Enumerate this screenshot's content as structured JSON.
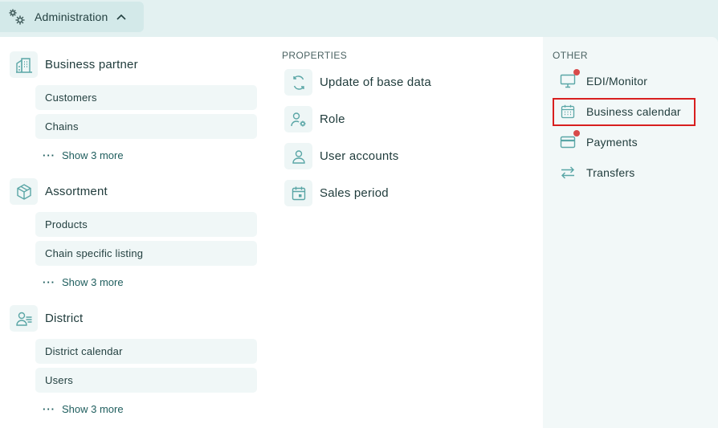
{
  "header": {
    "menu_label": "Administration"
  },
  "groups": [
    {
      "title": "Business partner",
      "icon": "building-icon",
      "items": [
        "Customers",
        "Chains"
      ],
      "show_more": "Show 3 more"
    },
    {
      "title": "Assortment",
      "icon": "box-icon",
      "items": [
        "Products",
        "Chain specific listing"
      ],
      "show_more": "Show 3 more"
    },
    {
      "title": "District",
      "icon": "user-group-icon",
      "items": [
        "District calendar",
        "Users"
      ],
      "show_more": "Show 3 more"
    }
  ],
  "properties": {
    "heading": "PROPERTIES",
    "items": [
      {
        "label": "Update of base data",
        "icon": "refresh-icon"
      },
      {
        "label": "Role",
        "icon": "user-gear-icon"
      },
      {
        "label": "User accounts",
        "icon": "user-icon"
      },
      {
        "label": "Sales period",
        "icon": "calendar-icon"
      }
    ]
  },
  "other": {
    "heading": "OTHER",
    "items": [
      {
        "label": "EDI/Monitor",
        "icon": "monitor-icon",
        "badge": true
      },
      {
        "label": "Business calendar",
        "icon": "calendar-grid-icon",
        "badge": false,
        "highlighted": true
      },
      {
        "label": "Payments",
        "icon": "credit-card-icon",
        "badge": true
      },
      {
        "label": "Transfers",
        "icon": "transfer-arrows-icon",
        "badge": false
      }
    ]
  },
  "colors": {
    "accent": "#5aa6a6",
    "badge": "#d84a4a",
    "highlight_border": "#d81f1f"
  }
}
